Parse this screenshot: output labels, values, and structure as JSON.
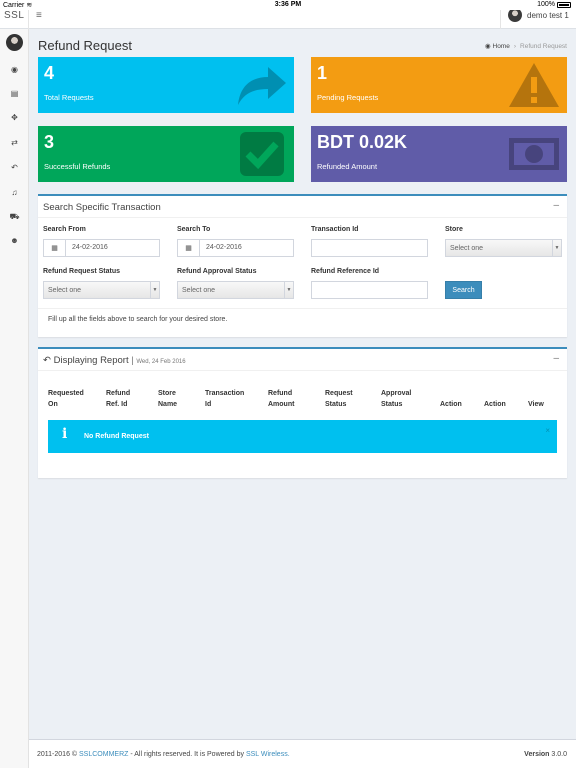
{
  "status_bar": {
    "carrier": "Carrier",
    "time": "3:36 PM",
    "battery": "100%"
  },
  "header": {
    "brand": "SSL",
    "menu_glyph": "≡",
    "user_name": "demo test 1"
  },
  "sidebar": {
    "items": [
      {
        "icon": "dashboard-icon",
        "glyph": "◉"
      },
      {
        "icon": "list-icon",
        "glyph": "▤"
      },
      {
        "icon": "crosshair-icon",
        "glyph": "✥"
      },
      {
        "icon": "exchange-icon",
        "glyph": "⇄"
      },
      {
        "icon": "reply-icon",
        "glyph": "↶"
      },
      {
        "icon": "bell-icon",
        "glyph": "♫"
      },
      {
        "icon": "cart-icon",
        "glyph": "⛟"
      },
      {
        "icon": "users-icon",
        "glyph": "☻"
      }
    ]
  },
  "page": {
    "title": "Refund Request",
    "breadcrumb": {
      "home": "Home",
      "current": "Refund Request"
    }
  },
  "stats": [
    {
      "value": "4",
      "label": "Total Requests",
      "icon": "share-arrow-icon",
      "color": "#00c0ef"
    },
    {
      "value": "1",
      "label": "Pending Requests",
      "icon": "warning-icon",
      "color": "#f39c12"
    },
    {
      "value": "3",
      "label": "Successful Refunds",
      "icon": "checkbox-icon",
      "color": "#00a65a"
    },
    {
      "value": "BDT 0.02K",
      "label": "Refunded Amount",
      "icon": "money-icon",
      "color": "#605ca8"
    }
  ],
  "search": {
    "title": "Search Specific Transaction",
    "collapse_glyph": "–",
    "search_from": {
      "label": "Search From",
      "value": "24-02-2016"
    },
    "search_to": {
      "label": "Search To",
      "value": "24-02-2016"
    },
    "transaction_id": {
      "label": "Transaction Id",
      "value": ""
    },
    "store": {
      "label": "Store",
      "value": "Select one"
    },
    "refund_request_status": {
      "label": "Refund Request Status",
      "value": "Select one"
    },
    "refund_approval_status": {
      "label": "Refund Approval Status",
      "value": "Select one"
    },
    "refund_reference_id": {
      "label": "Refund Reference Id",
      "value": ""
    },
    "button": "Search",
    "hint": "Fill up all the fields above to search for your desired store."
  },
  "report": {
    "title": "Displaying Report",
    "date": "Wed, 24 Feb 2016",
    "collapse_glyph": "–",
    "columns": [
      {
        "line1": "Requested",
        "line2": "On"
      },
      {
        "line1": "Refund",
        "line2": "Ref. Id"
      },
      {
        "line1": "Store",
        "line2": "Name"
      },
      {
        "line1": "Transaction",
        "line2": "Id"
      },
      {
        "line1": "Refund",
        "line2": "Amount"
      },
      {
        "line1": "Request",
        "line2": "Status"
      },
      {
        "line1": "Approval",
        "line2": "Status"
      },
      {
        "line1": "",
        "line2": "Action"
      },
      {
        "line1": "",
        "line2": "Action"
      },
      {
        "line1": "",
        "line2": "View"
      }
    ],
    "alert": {
      "icon": "info-icon",
      "glyph": "i",
      "text": "No Refund Request",
      "close": "×"
    }
  },
  "footer": {
    "prefix": "2011-2016 ©",
    "link1": "SSLCOMMERZ",
    "middle": "- All rights reserved. It is Powered by",
    "link2": "SSL Wireless.",
    "version_label": "Version",
    "version": "3.0.0"
  },
  "colors": {
    "accent": "#3c8dbc",
    "info": "#00c0ef",
    "warning": "#f39c12",
    "success": "#00a65a",
    "purple": "#605ca8"
  }
}
